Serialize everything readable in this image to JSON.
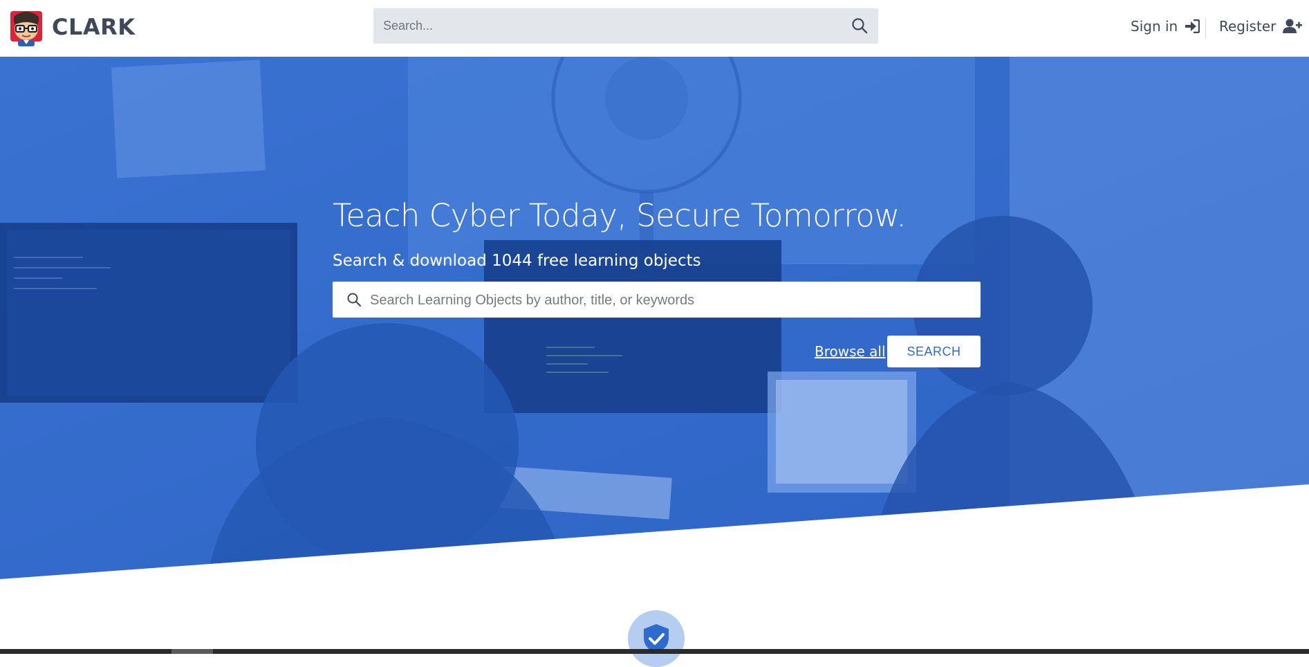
{
  "header": {
    "brand": "CLARK",
    "search_placeholder": "Search...",
    "signin_label": "Sign in",
    "register_label": "Register"
  },
  "hero": {
    "title": "Teach Cyber Today, Secure Tomorrow.",
    "subtitle": "Search & download 1044 free learning objects",
    "search_placeholder": "Search Learning Objects by author, title, or keywords",
    "browse_all_label": "Browse all",
    "search_button_label": "SEARCH"
  },
  "icons": {
    "header_search": "search-icon",
    "signin": "sign-in-icon",
    "register": "user-plus-icon",
    "hero_search": "search-icon",
    "feature": "shield-check-icon"
  },
  "colors": {
    "brand_blue": "#2f6bce",
    "header_text": "#3e4a57",
    "search_bg": "#e3e6eb"
  }
}
